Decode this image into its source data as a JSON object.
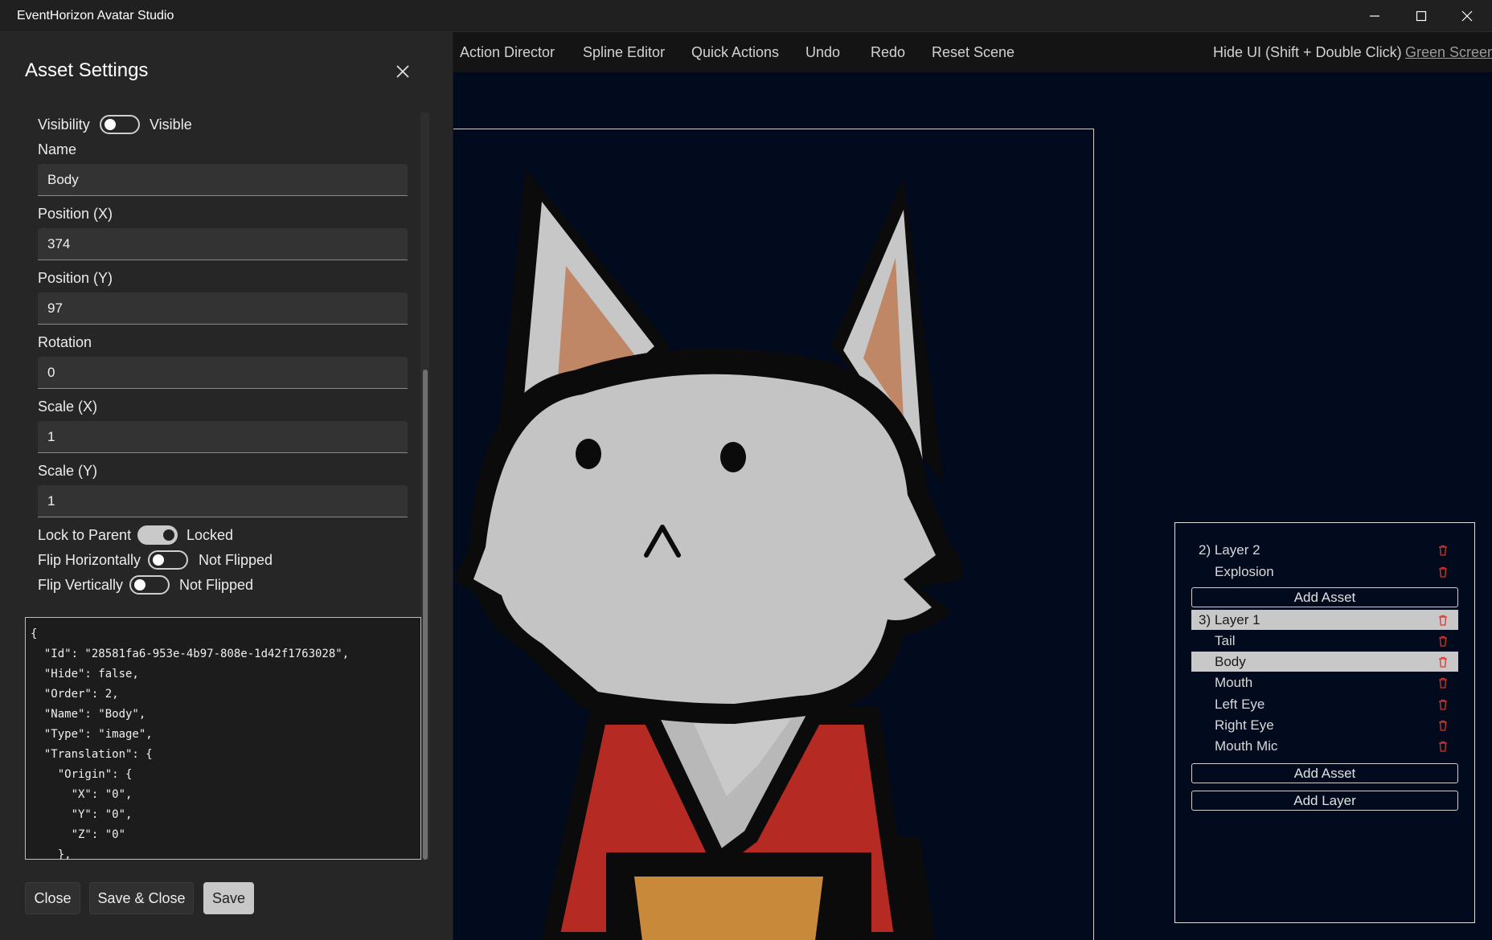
{
  "window": {
    "title": "EventHorizon Avatar Studio",
    "minimize_icon": "minimize-icon",
    "maximize_icon": "maximize-icon",
    "close_icon": "close-icon"
  },
  "toolbar": {
    "items": [
      "Action Director",
      "Spline Editor",
      "Quick Actions",
      "Undo",
      "Redo",
      "Reset Scene"
    ],
    "hide_ui": "Hide UI (Shift + Double Click)",
    "green_screen": "Green Screen"
  },
  "settings": {
    "title": "Asset Settings",
    "visibility": {
      "label": "Visibility",
      "on": false,
      "state": "Visible"
    },
    "fields": [
      {
        "label": "Name",
        "value": "Body"
      },
      {
        "label": "Position (X)",
        "value": "374"
      },
      {
        "label": "Position (Y)",
        "value": "97"
      },
      {
        "label": "Rotation",
        "value": "0"
      },
      {
        "label": "Scale (X)",
        "value": "1"
      },
      {
        "label": "Scale (Y)",
        "value": "1"
      }
    ],
    "lock_to_parent": {
      "label": "Lock to Parent",
      "on": true,
      "state": "Locked"
    },
    "flip_h": {
      "label": "Flip Horizontally",
      "on": false,
      "state": "Not Flipped"
    },
    "flip_v": {
      "label": "Flip Vertically",
      "on": false,
      "state": "Not Flipped"
    },
    "json_lines": [
      "{",
      "  \"Id\": \"28581fa6-953e-4b97-808e-1d42f1763028\",",
      "  \"Hide\": false,",
      "  \"Order\": 2,",
      "  \"Name\": \"Body\",",
      "  \"Type\": \"image\",",
      "  \"Translation\": {",
      "    \"Origin\": {",
      "      \"X\": \"0\",",
      "      \"Y\": \"0\",",
      "      \"Z\": \"0\"",
      "    },"
    ],
    "buttons": {
      "close": "Close",
      "save_close": "Save & Close",
      "save": "Save"
    }
  },
  "layers": {
    "rows": [
      {
        "label": "2) Layer 2",
        "kind": "layer",
        "selected": false
      },
      {
        "label": "Explosion",
        "kind": "asset",
        "selected": false
      },
      {
        "label": "3) Layer 1",
        "kind": "layer",
        "selected": true
      },
      {
        "label": "Tail",
        "kind": "asset",
        "selected": false
      },
      {
        "label": "Body",
        "kind": "asset",
        "selected": true
      },
      {
        "label": "Mouth",
        "kind": "asset",
        "selected": false
      },
      {
        "label": "Left Eye",
        "kind": "asset",
        "selected": false
      },
      {
        "label": "Right Eye",
        "kind": "asset",
        "selected": false
      },
      {
        "label": "Mouth Mic",
        "kind": "asset",
        "selected": false
      }
    ],
    "add_asset": "Add Asset",
    "add_layer": "Add Layer",
    "trash_icon": "trash-icon",
    "trash_color": "#d9342b"
  },
  "colors": {
    "stage_bg": "#020b1e",
    "panel_bg": "#262626",
    "selected_row": "#c8c8c8"
  }
}
